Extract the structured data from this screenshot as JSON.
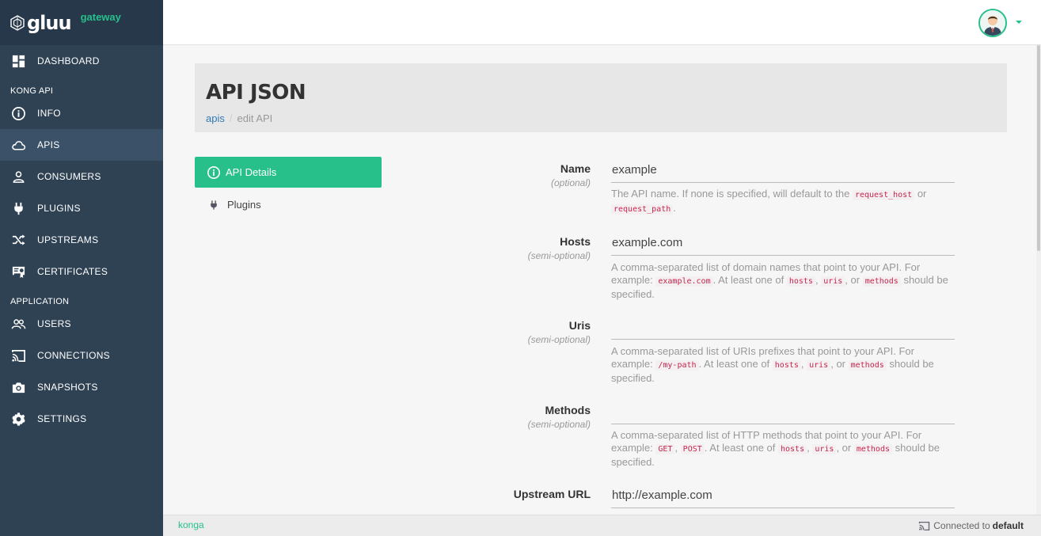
{
  "brand": {
    "name": "gluu",
    "sub": "gateway"
  },
  "sidebar": {
    "dashboard": "DASHBOARD",
    "section_kong": "KONG API",
    "kong_items": [
      {
        "label": "INFO",
        "icon": "info-icon"
      },
      {
        "label": "APIS",
        "icon": "cloud-icon"
      },
      {
        "label": "CONSUMERS",
        "icon": "user-icon"
      },
      {
        "label": "PLUGINS",
        "icon": "plug-icon"
      },
      {
        "label": "UPSTREAMS",
        "icon": "shuffle-icon"
      },
      {
        "label": "CERTIFICATES",
        "icon": "certificate-icon"
      }
    ],
    "section_app": "APPLICATION",
    "app_items": [
      {
        "label": "USERS",
        "icon": "users-icon"
      },
      {
        "label": "CONNECTIONS",
        "icon": "cast-icon"
      },
      {
        "label": "SNAPSHOTS",
        "icon": "camera-icon"
      },
      {
        "label": "SETTINGS",
        "icon": "gear-icon"
      }
    ],
    "active": "APIS"
  },
  "header": {
    "title": "API JSON",
    "breadcrumb_link": "apis",
    "breadcrumb_sep": "/",
    "breadcrumb_current": "edit API"
  },
  "tabs": {
    "details": "API Details",
    "plugins": "Plugins"
  },
  "form": {
    "name": {
      "label": "Name",
      "sub": "(optional)",
      "value": "example",
      "help_pre": "The API name. If none is specified, will default to the ",
      "code1": "request_host",
      "help_mid": " or ",
      "code2": "request_path",
      "help_post": "."
    },
    "hosts": {
      "label": "Hosts",
      "sub": "(semi-optional)",
      "value": "example.com",
      "help_pre": "A comma-separated list of domain names that point to your API. For example: ",
      "code0": "example.com",
      "help_a": ". At least one of ",
      "code1": "hosts",
      "help_b": ", ",
      "code2": "uris",
      "help_c": ", or ",
      "code3": "methods",
      "help_post": " should be specified."
    },
    "uris": {
      "label": "Uris",
      "sub": "(semi-optional)",
      "value": "",
      "help_pre": "A comma-separated list of URIs prefixes that point to your API. For example: ",
      "code0": "/my-path",
      "help_a": ". At least one of ",
      "code1": "hosts",
      "help_b": ", ",
      "code2": "uris",
      "help_c": ", or ",
      "code3": "methods",
      "help_post": " should be specified."
    },
    "methods": {
      "label": "Methods",
      "sub": "(semi-optional)",
      "value": "",
      "help_pre": "A comma-separated list of HTTP methods that point to your API. For example: ",
      "code0a": "GET",
      "help_x": ", ",
      "code0b": "POST",
      "help_a": ". At least one of ",
      "code1": "hosts",
      "help_b": ", ",
      "code2": "uris",
      "help_c": ", or ",
      "code3": "methods",
      "help_post": " should be specified."
    },
    "upstream": {
      "label": "Upstream URL",
      "value": "http://example.com"
    }
  },
  "footer": {
    "brand": "konga",
    "connected_prefix": "Connected to",
    "connected_name": "default"
  },
  "colors": {
    "accent": "#27c08b",
    "sidebar": "#2f4254",
    "link": "#337ab7"
  }
}
